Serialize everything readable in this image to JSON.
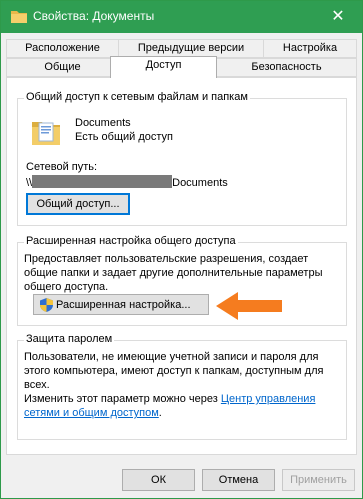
{
  "window": {
    "title": "Свойства: Документы",
    "close_glyph": "✕"
  },
  "tabs": {
    "row_top": [
      "Расположение",
      "Предыдущие версии",
      "Настройка"
    ],
    "row_bottom": [
      "Общие",
      "Доступ",
      "Безопасность"
    ]
  },
  "sharing_group": {
    "title": "Общий доступ к сетевым файлам и папкам",
    "folder_name": "Documents",
    "folder_status": "Есть общий доступ",
    "network_path_label": "Сетевой путь:",
    "network_path_prefix": "\\\\",
    "network_path_suffix": "Documents",
    "share_button": "Общий доступ..."
  },
  "advanced_group": {
    "title": "Расширенная настройка общего доступа",
    "description": "Предоставляет пользовательские разрешения, создает общие папки и задает другие дополнительные параметры общего доступа.",
    "button": "Расширенная настройка..."
  },
  "password_group": {
    "title": "Защита паролем",
    "description": "Пользователи, не имеющие учетной записи и пароля для этого компьютера, имеют доступ к папкам, доступным для всех.",
    "change_text": "Изменить этот параметр можно через ",
    "link_text": "Центр управления сетями и общим доступом",
    "link_suffix": "."
  },
  "footer": {
    "ok": "ОК",
    "cancel": "Отмена",
    "apply": "Применить"
  },
  "colors": {
    "titlebar": "#2f9e52",
    "link": "#0066cc",
    "arrow": "#f57c1f"
  }
}
